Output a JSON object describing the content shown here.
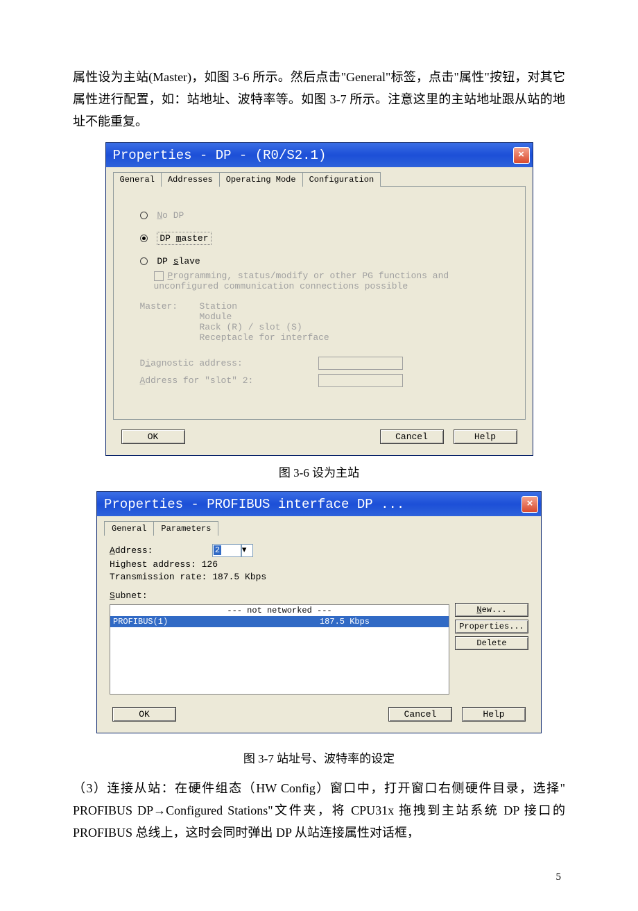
{
  "para1": "属性设为主站(Master)，如图 3-6 所示。然后点击\"General\"标签，点击\"属性\"按钮，对其它属性进行配置，如：站地址、波特率等。如图 3-7 所示。注意这里的主站地址跟从站的地址不能重复。",
  "caption1": "图 3-6 设为主站",
  "caption2": "图 3-7 站址号、波特率的设定",
  "para2": "（3）连接从站：在硬件组态（HW Config）窗口中，打开窗口右侧硬件目录，选择\" PROFIBUS DP→Configured Stations\"文件夹，将 CPU31x 拖拽到主站系统 DP 接口的 PROFIBUS 总线上，这时会同时弹出 DP 从站连接属性对话框，",
  "page_num": "5",
  "dlg1": {
    "title": "Properties - DP - (R0/S2.1)",
    "tabs": {
      "general": "General",
      "addresses": "Addresses",
      "operating": "Operating Mode",
      "config": "Configuration"
    },
    "radios": {
      "noDp_pre": "N",
      "noDp_rest": "o DP",
      "master_pre": "DP ",
      "master_u": "m",
      "master_rest": "aster",
      "slave_pre": "DP ",
      "slave_u": "s",
      "slave_rest": "lave"
    },
    "chk_pre": "P",
    "chk_text": "rogramming, status/modify or other PG functions and unconfigured communication connections possible",
    "master_label": "Master:",
    "master_lines": {
      "l1": "Station",
      "l2": "Module",
      "l3": "Rack (R) / slot (S)",
      "l4": "Receptacle for interface"
    },
    "diag_pre": "D",
    "diag_u": "i",
    "diag_rest": "agnostic address:",
    "slot2_pre": "A",
    "slot2_rest": "ddress for \"slot\" 2:",
    "ok": "OK",
    "cancel": "Cancel",
    "help": "Help"
  },
  "dlg2": {
    "title": "Properties - PROFIBUS interface  DP ...",
    "tabs": {
      "general": "General",
      "parameters": "Parameters"
    },
    "addr_u": "A",
    "addr_rest": "ddress:",
    "addr_val": "2",
    "highest": "Highest address:  126",
    "trans": "Transmission rate: 187.5 Kbps",
    "subnet_u": "S",
    "subnet_rest": "ubnet:",
    "row1": "--- not networked ---",
    "row2_name": "PROFIBUS(1)",
    "row2_rate": "187.5 Kbps",
    "new_u": "N",
    "new_rest": "ew...",
    "prop": "Properties...",
    "delete": "Delete",
    "ok": "OK",
    "cancel": "Cancel",
    "help": "Help"
  }
}
